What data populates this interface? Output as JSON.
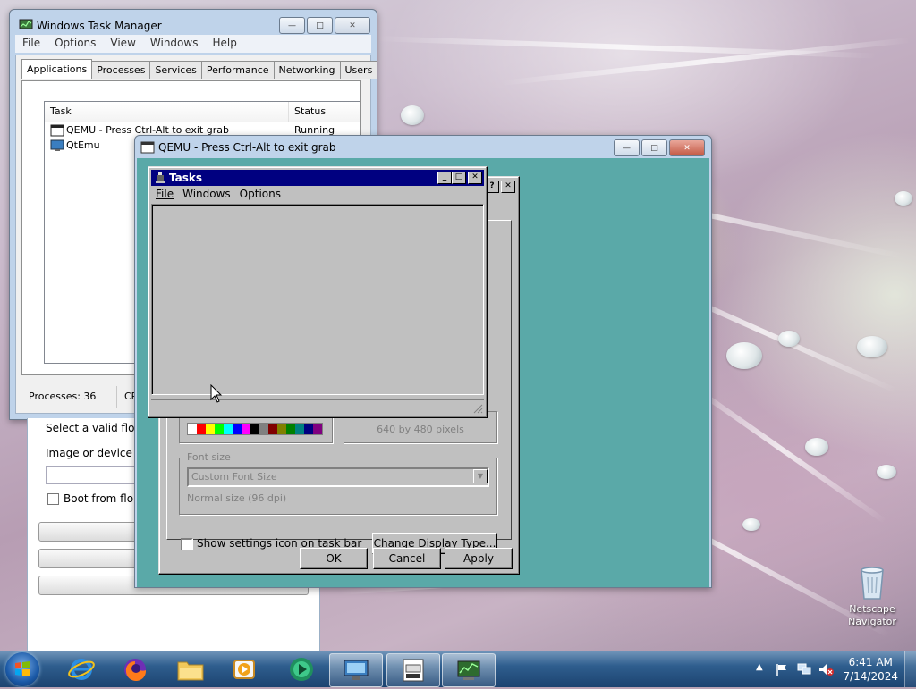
{
  "taskmgr": {
    "title": "Windows Task Manager",
    "menu": [
      "File",
      "Options",
      "View",
      "Windows",
      "Help"
    ],
    "tabs": [
      "Applications",
      "Processes",
      "Services",
      "Performance",
      "Networking",
      "Users"
    ],
    "columns": {
      "task": "Task",
      "status": "Status"
    },
    "rows": [
      {
        "task": "QEMU - Press Ctrl-Alt to exit grab",
        "status": "Running"
      },
      {
        "task": "QtEmu",
        "status": ""
      }
    ],
    "statusbar": {
      "processes": "Processes: 36",
      "cpu": "CPU"
    }
  },
  "qtemu_partial": {
    "floppy_label": "Select a valid floppy",
    "image_label": "Image or device for f",
    "boot_floppy": "Boot from floppy"
  },
  "qemu": {
    "title": "QEMU - Press Ctrl-Alt to exit grab"
  },
  "display_dialog": {
    "resolution_text": "640 by 480 pixels",
    "font_size_group": "Font size",
    "font_size_value": "Custom Font Size",
    "normal_size": "Normal size (96 dpi)",
    "show_settings_icon": "Show settings icon on task bar",
    "change_display_type": "Change Display Type...",
    "ok": "OK",
    "cancel": "Cancel",
    "apply": "Apply",
    "palette": [
      "#ffffff",
      "#ff0000",
      "#ffff00",
      "#00ff00",
      "#00ffff",
      "#0000ff",
      "#ff00ff",
      "#000000",
      "#808080",
      "#800000",
      "#808000",
      "#008000",
      "#008080",
      "#000080",
      "#800080"
    ]
  },
  "tasks_window": {
    "title": "Tasks",
    "menu": [
      "File",
      "Windows",
      "Options"
    ]
  },
  "desktop": {
    "recycle_label": "Netscape\nNavigator"
  },
  "taskbar": {
    "time": "6:41 AM",
    "date": "7/14/2024"
  }
}
